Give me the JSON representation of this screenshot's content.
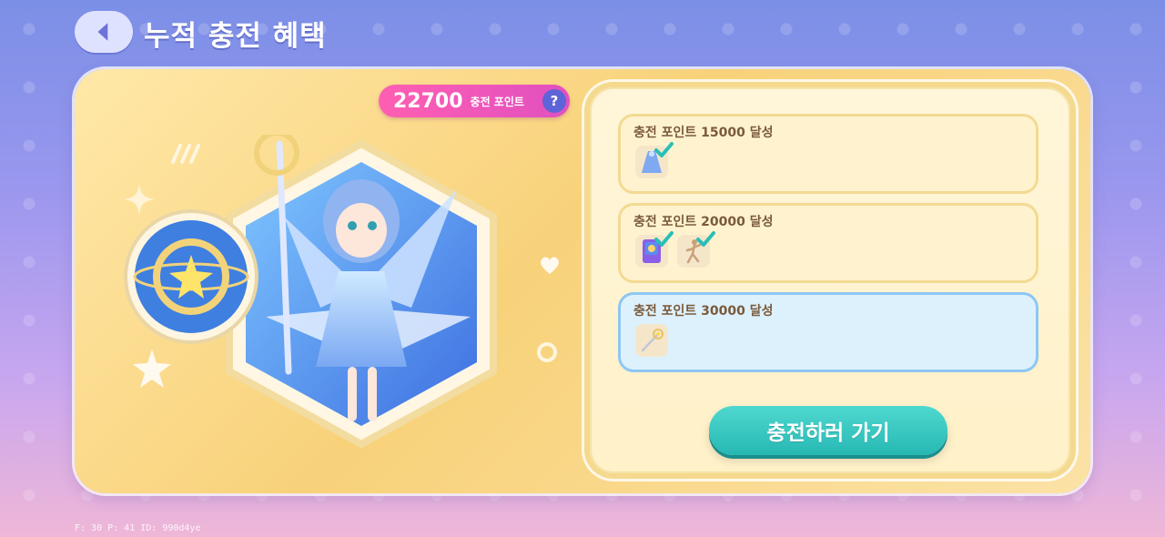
{
  "header": {
    "title": "누적 충전 혜택"
  },
  "points": {
    "value": "22700",
    "label": "충전 포인트",
    "help": "?"
  },
  "rewards": [
    {
      "title": "충전 포인트 15000 달성",
      "claimed": true,
      "icons": [
        "blue-dress-icon"
      ]
    },
    {
      "title": "충전 포인트 20000 달성",
      "claimed": true,
      "icons": [
        "photo-card-icon",
        "dance-pose-icon"
      ]
    },
    {
      "title": "충전 포인트 30000 달성",
      "claimed": false,
      "selected": true,
      "icons": [
        "star-wand-icon"
      ]
    }
  ],
  "actions": {
    "go_charge": "충전하러 가기"
  },
  "debug": {
    "text": "F: 30    P: 41    ID: 990d4ye"
  },
  "colors": {
    "accent_pink": "#ff5fb1",
    "accent_teal": "#27b8b4",
    "panel_yellow": "#f8d27a"
  }
}
